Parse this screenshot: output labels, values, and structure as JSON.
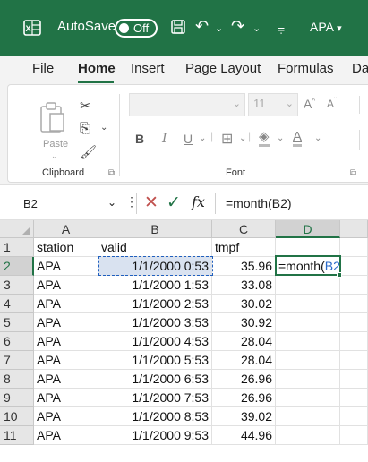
{
  "titlebar": {
    "autosave_label": "AutoSave",
    "autosave_state": "Off",
    "profile_label": "APA",
    "icons": [
      "excel-logo-icon",
      "save-icon",
      "undo-icon",
      "redo-icon",
      "customize-icon",
      "chevron-down-icon"
    ],
    "bg": "#217346"
  },
  "tabs": [
    {
      "label": "File"
    },
    {
      "label": "Home",
      "active": true
    },
    {
      "label": "Insert"
    },
    {
      "label": "Page Layout"
    },
    {
      "label": "Formulas"
    },
    {
      "label": "Da"
    }
  ],
  "ribbon": {
    "paste_label": "Paste",
    "clipboard_label": "Clipboard",
    "font_label": "Font",
    "font_size": "11"
  },
  "formula_bar": {
    "name_box": "B2",
    "formula": "=month(B2)"
  },
  "grid": {
    "columns": [
      "A",
      "B",
      "C",
      "D"
    ],
    "rows": [
      {
        "n": "1",
        "a": "station",
        "b": "valid",
        "c": "tmpf",
        "d": ""
      },
      {
        "n": "2",
        "a": "APA",
        "b": "1/1/2000 0:53",
        "c": "35.96",
        "d": "=month("
      },
      {
        "n": "3",
        "a": "APA",
        "b": "1/1/2000 1:53",
        "c": "33.08",
        "d": ""
      },
      {
        "n": "4",
        "a": "APA",
        "b": "1/1/2000 2:53",
        "c": "30.02",
        "d": ""
      },
      {
        "n": "5",
        "a": "APA",
        "b": "1/1/2000 3:53",
        "c": "30.92",
        "d": ""
      },
      {
        "n": "6",
        "a": "APA",
        "b": "1/1/2000 4:53",
        "c": "28.04",
        "d": ""
      },
      {
        "n": "7",
        "a": "APA",
        "b": "1/1/2000 5:53",
        "c": "28.04",
        "d": ""
      },
      {
        "n": "8",
        "a": "APA",
        "b": "1/1/2000 6:53",
        "c": "26.96",
        "d": ""
      },
      {
        "n": "9",
        "a": "APA",
        "b": "1/1/2000 7:53",
        "c": "26.96",
        "d": ""
      },
      {
        "n": "10",
        "a": "APA",
        "b": "1/1/2000 8:53",
        "c": "39.02",
        "d": ""
      },
      {
        "n": "11",
        "a": "APA",
        "b": "1/1/2000 9:53",
        "c": "44.96",
        "d": ""
      }
    ],
    "d2_ref": "B2",
    "d2_close": ")",
    "active_cell": "D2",
    "referenced_cell": "B2"
  }
}
